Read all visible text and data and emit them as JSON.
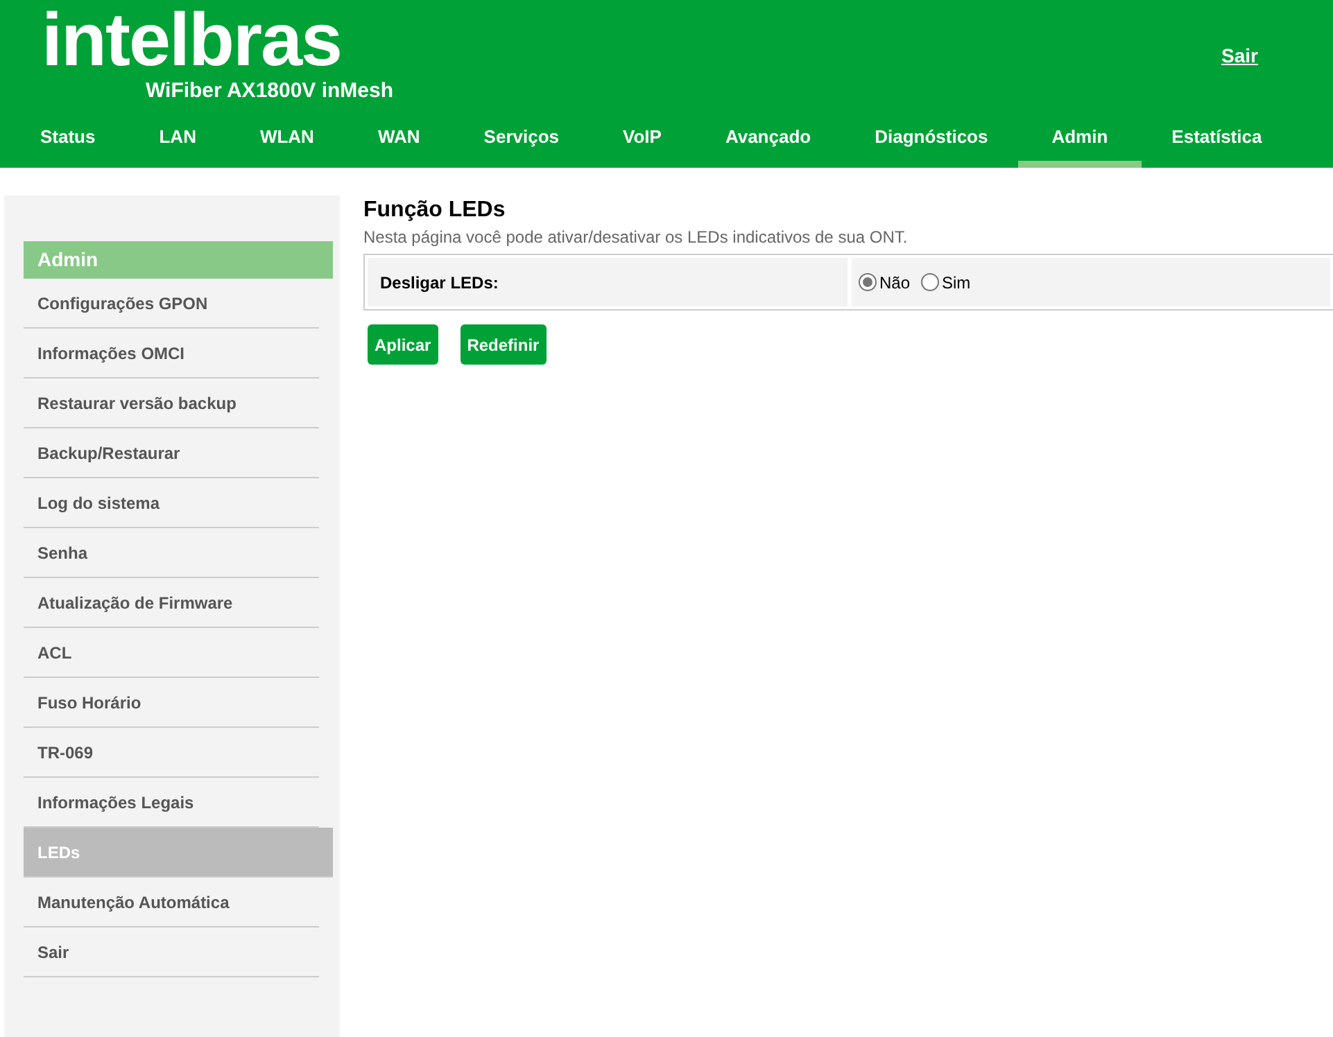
{
  "header": {
    "logo": "intelbras",
    "model": "WiFiber AX1800V inMesh",
    "logout_link": "Sair"
  },
  "tabs": [
    {
      "label": "Status",
      "selected": false
    },
    {
      "label": "LAN",
      "selected": false
    },
    {
      "label": "WLAN",
      "selected": false
    },
    {
      "label": "WAN",
      "selected": false
    },
    {
      "label": "Serviços",
      "selected": false
    },
    {
      "label": "VoIP",
      "selected": false
    },
    {
      "label": "Avançado",
      "selected": false
    },
    {
      "label": "Diagnósticos",
      "selected": false
    },
    {
      "label": "Admin",
      "selected": true
    },
    {
      "label": "Estatística",
      "selected": false
    }
  ],
  "sidebar": {
    "title": "Admin",
    "items": [
      {
        "label": "Configurações GPON",
        "selected": false
      },
      {
        "label": "Informações OMCI",
        "selected": false
      },
      {
        "label": "Restaurar versão backup",
        "selected": false
      },
      {
        "label": "Backup/Restaurar",
        "selected": false
      },
      {
        "label": "Log do sistema",
        "selected": false
      },
      {
        "label": "Senha",
        "selected": false
      },
      {
        "label": "Atualização de Firmware",
        "selected": false
      },
      {
        "label": "ACL",
        "selected": false
      },
      {
        "label": "Fuso Horário",
        "selected": false
      },
      {
        "label": "TR-069",
        "selected": false
      },
      {
        "label": "Informações Legais",
        "selected": false
      },
      {
        "label": "LEDs",
        "selected": true
      },
      {
        "label": "Manutenção Automática",
        "selected": false
      },
      {
        "label": "Sair",
        "selected": false
      }
    ]
  },
  "page": {
    "title": "Função LEDs",
    "description": "Nesta página você pode ativar/desativar os LEDs indicativos de sua ONT.",
    "form": {
      "label": "Desligar LEDs:",
      "options": [
        {
          "label": "Não",
          "selected": true
        },
        {
          "label": "Sim",
          "selected": false
        }
      ]
    },
    "buttons": [
      "Aplicar",
      "Redefinir"
    ]
  }
}
